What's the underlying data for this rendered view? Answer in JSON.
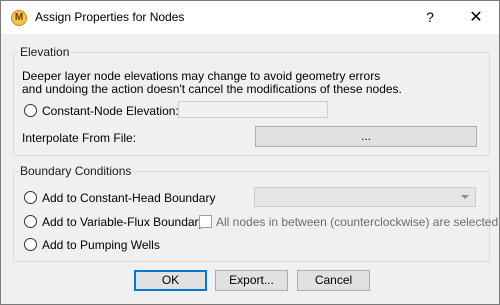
{
  "window": {
    "title": "Assign Properties for Nodes",
    "help_glyph": "?",
    "close_glyph": "✕",
    "app_icon_glyph": "M"
  },
  "elevation": {
    "group_label": "Elevation",
    "description_line1": "Deeper layer node elevations may change to avoid geometry errors",
    "description_line2": "and undoing the action doesn't cancel the modifications of these nodes.",
    "constant_node_label": "Constant-Node Elevation:",
    "constant_node_value": "",
    "interpolate_label": "Interpolate From File:",
    "browse_label": "..."
  },
  "boundary": {
    "group_label": "Boundary Conditions",
    "constant_head_label": "Add to Constant-Head Boundary",
    "constant_head_selected": "",
    "variable_flux_label": "Add to Variable-Flux Boundary",
    "all_nodes_label": "All nodes in between (counterclockwise) are selected.",
    "pumping_wells_label": "Add to Pumping Wells"
  },
  "buttons": {
    "ok": "OK",
    "export": "Export...",
    "cancel": "Cancel"
  },
  "colors": {
    "dialog_bg": "#f0f0f0",
    "titlebar_bg": "#ffffff",
    "default_button_border": "#0078d7",
    "disabled_text": "#6d6d6d"
  },
  "icons": {
    "app": "app-logo-icon",
    "help": "help-icon",
    "close": "close-icon",
    "dropdown": "chevron-down-icon"
  }
}
